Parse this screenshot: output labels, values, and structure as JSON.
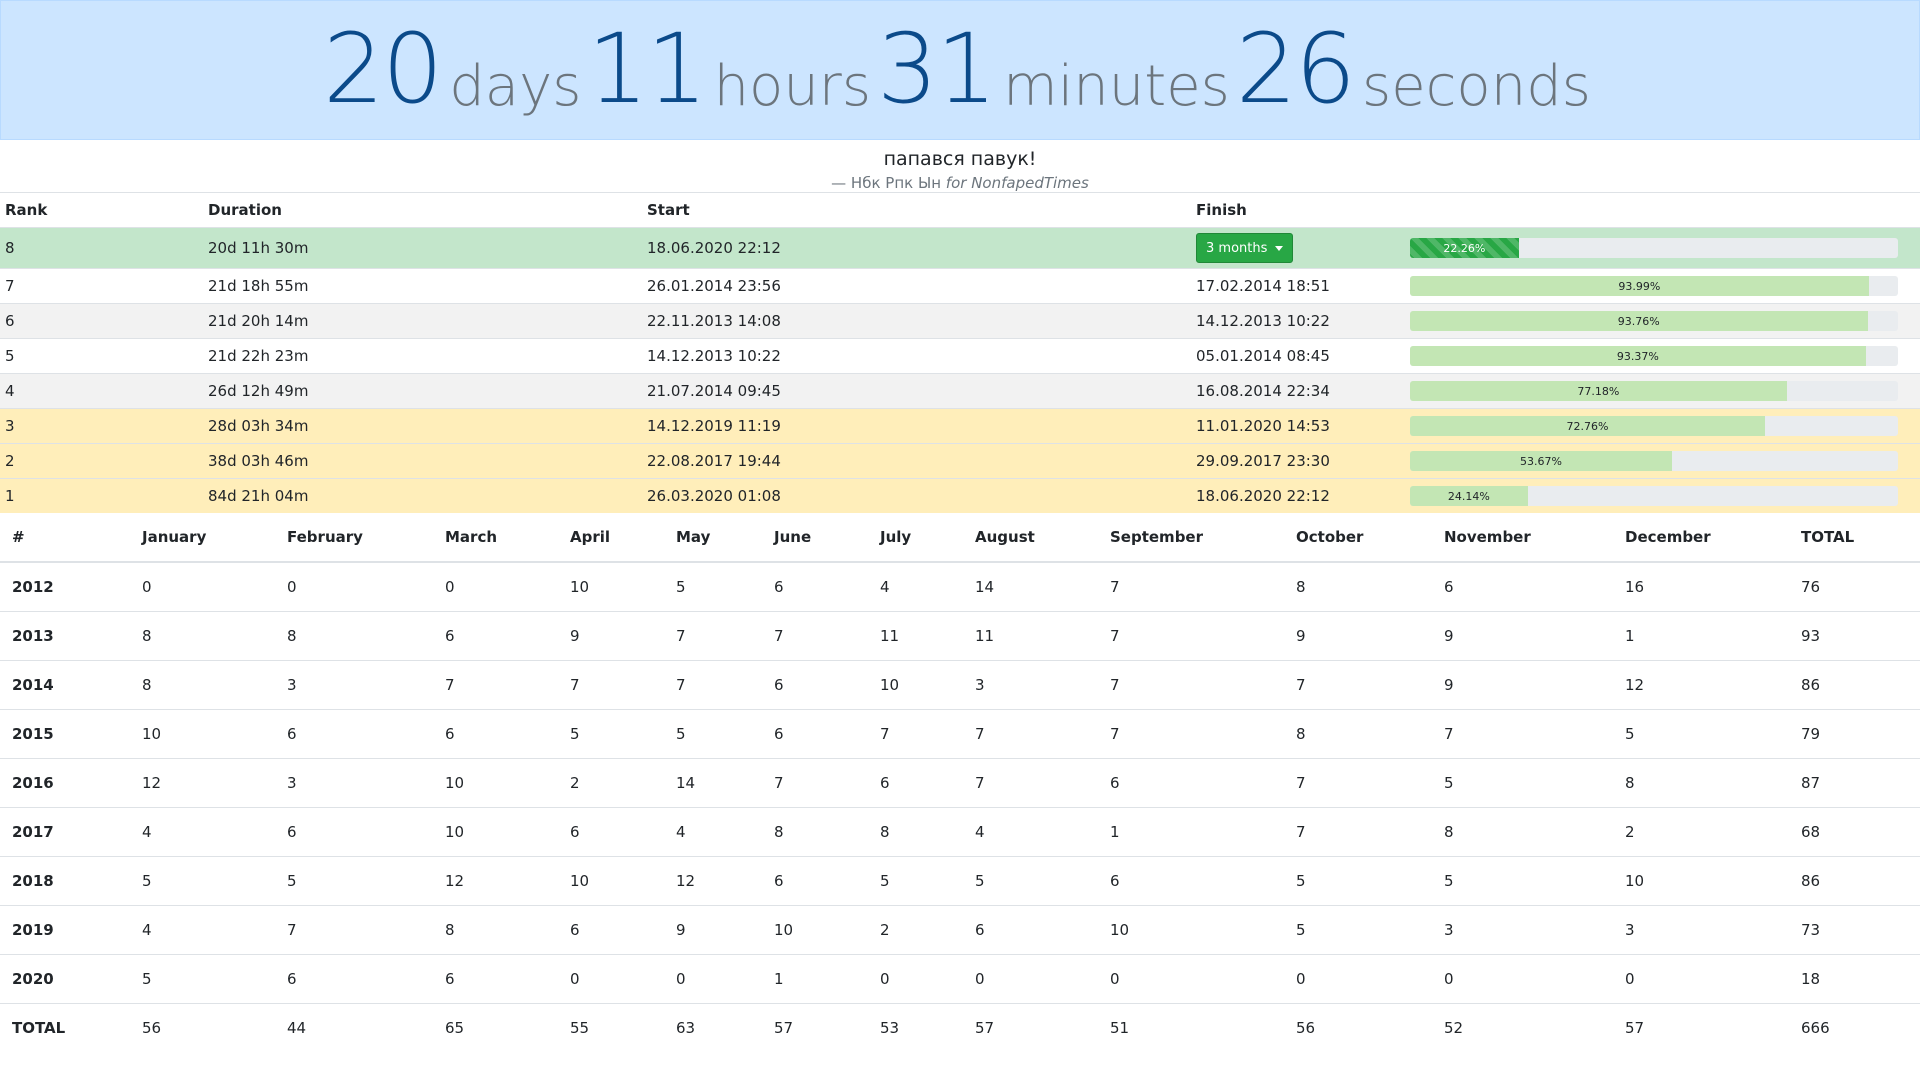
{
  "countdown": {
    "days_value": "20",
    "days_label": "days",
    "hours_value": "11",
    "hours_label": "hours",
    "minutes_value": "31",
    "minutes_label": "minutes",
    "seconds_value": "26",
    "seconds_label": "seconds"
  },
  "quote": {
    "text": "папався павук!",
    "author_prefix": "— Нбк Рпк Ын",
    "for_word": "for",
    "source": "NonfapedTimes"
  },
  "ranking": {
    "headers": [
      "Rank",
      "Duration",
      "Start",
      "Finish",
      ""
    ],
    "current": {
      "rank": "8",
      "duration": "20d 11h 30m",
      "start": "18.06.2020 22:12",
      "dropdown_label": "3 months",
      "progress": 22.26,
      "progress_label": "22.26%"
    },
    "rows": [
      {
        "rank": "7",
        "duration": "21d 18h 55m",
        "start": "26.01.2014 23:56",
        "finish": "17.02.2014 18:51",
        "progress": 93.99,
        "progress_label": "93.99%",
        "style": "odd"
      },
      {
        "rank": "6",
        "duration": "21d 20h 14m",
        "start": "22.11.2013 14:08",
        "finish": "14.12.2013 10:22",
        "progress": 93.76,
        "progress_label": "93.76%",
        "style": "even"
      },
      {
        "rank": "5",
        "duration": "21d 22h 23m",
        "start": "14.12.2013 10:22",
        "finish": "05.01.2014 08:45",
        "progress": 93.37,
        "progress_label": "93.37%",
        "style": "odd"
      },
      {
        "rank": "4",
        "duration": "26d 12h 49m",
        "start": "21.07.2014 09:45",
        "finish": "16.08.2014 22:34",
        "progress": 77.18,
        "progress_label": "77.18%",
        "style": "even"
      },
      {
        "rank": "3",
        "duration": "28d 03h 34m",
        "start": "14.12.2019 11:19",
        "finish": "11.01.2020 14:53",
        "progress": 72.76,
        "progress_label": "72.76%",
        "style": "top3"
      },
      {
        "rank": "2",
        "duration": "38d 03h 46m",
        "start": "22.08.2017 19:44",
        "finish": "29.09.2017 23:30",
        "progress": 53.67,
        "progress_label": "53.67%",
        "style": "top3"
      },
      {
        "rank": "1",
        "duration": "84d 21h 04m",
        "start": "26.03.2020 01:08",
        "finish": "18.06.2020 22:12",
        "progress": 24.14,
        "progress_label": "24.14%",
        "style": "top3"
      }
    ]
  },
  "monthly": {
    "headers": [
      "#",
      "January",
      "February",
      "March",
      "April",
      "May",
      "June",
      "July",
      "August",
      "September",
      "October",
      "November",
      "December",
      "TOTAL"
    ],
    "rows": [
      [
        "2012",
        "0",
        "0",
        "0",
        "10",
        "5",
        "6",
        "4",
        "14",
        "7",
        "8",
        "6",
        "16",
        "76"
      ],
      [
        "2013",
        "8",
        "8",
        "6",
        "9",
        "7",
        "7",
        "11",
        "11",
        "7",
        "9",
        "9",
        "1",
        "93"
      ],
      [
        "2014",
        "8",
        "3",
        "7",
        "7",
        "7",
        "6",
        "10",
        "3",
        "7",
        "7",
        "9",
        "12",
        "86"
      ],
      [
        "2015",
        "10",
        "6",
        "6",
        "5",
        "5",
        "6",
        "7",
        "7",
        "7",
        "8",
        "7",
        "5",
        "79"
      ],
      [
        "2016",
        "12",
        "3",
        "10",
        "2",
        "14",
        "7",
        "6",
        "7",
        "6",
        "7",
        "5",
        "8",
        "87"
      ],
      [
        "2017",
        "4",
        "6",
        "10",
        "6",
        "4",
        "8",
        "8",
        "4",
        "1",
        "7",
        "8",
        "2",
        "68"
      ],
      [
        "2018",
        "5",
        "5",
        "12",
        "10",
        "12",
        "6",
        "5",
        "5",
        "6",
        "5",
        "5",
        "10",
        "86"
      ],
      [
        "2019",
        "4",
        "7",
        "8",
        "6",
        "9",
        "10",
        "2",
        "6",
        "10",
        "5",
        "3",
        "3",
        "73"
      ],
      [
        "2020",
        "5",
        "6",
        "6",
        "0",
        "0",
        "1",
        "0",
        "0",
        "0",
        "0",
        "0",
        "0",
        "18"
      ],
      [
        "TOTAL",
        "56",
        "44",
        "65",
        "55",
        "63",
        "57",
        "53",
        "57",
        "51",
        "56",
        "52",
        "57",
        "666"
      ]
    ]
  }
}
